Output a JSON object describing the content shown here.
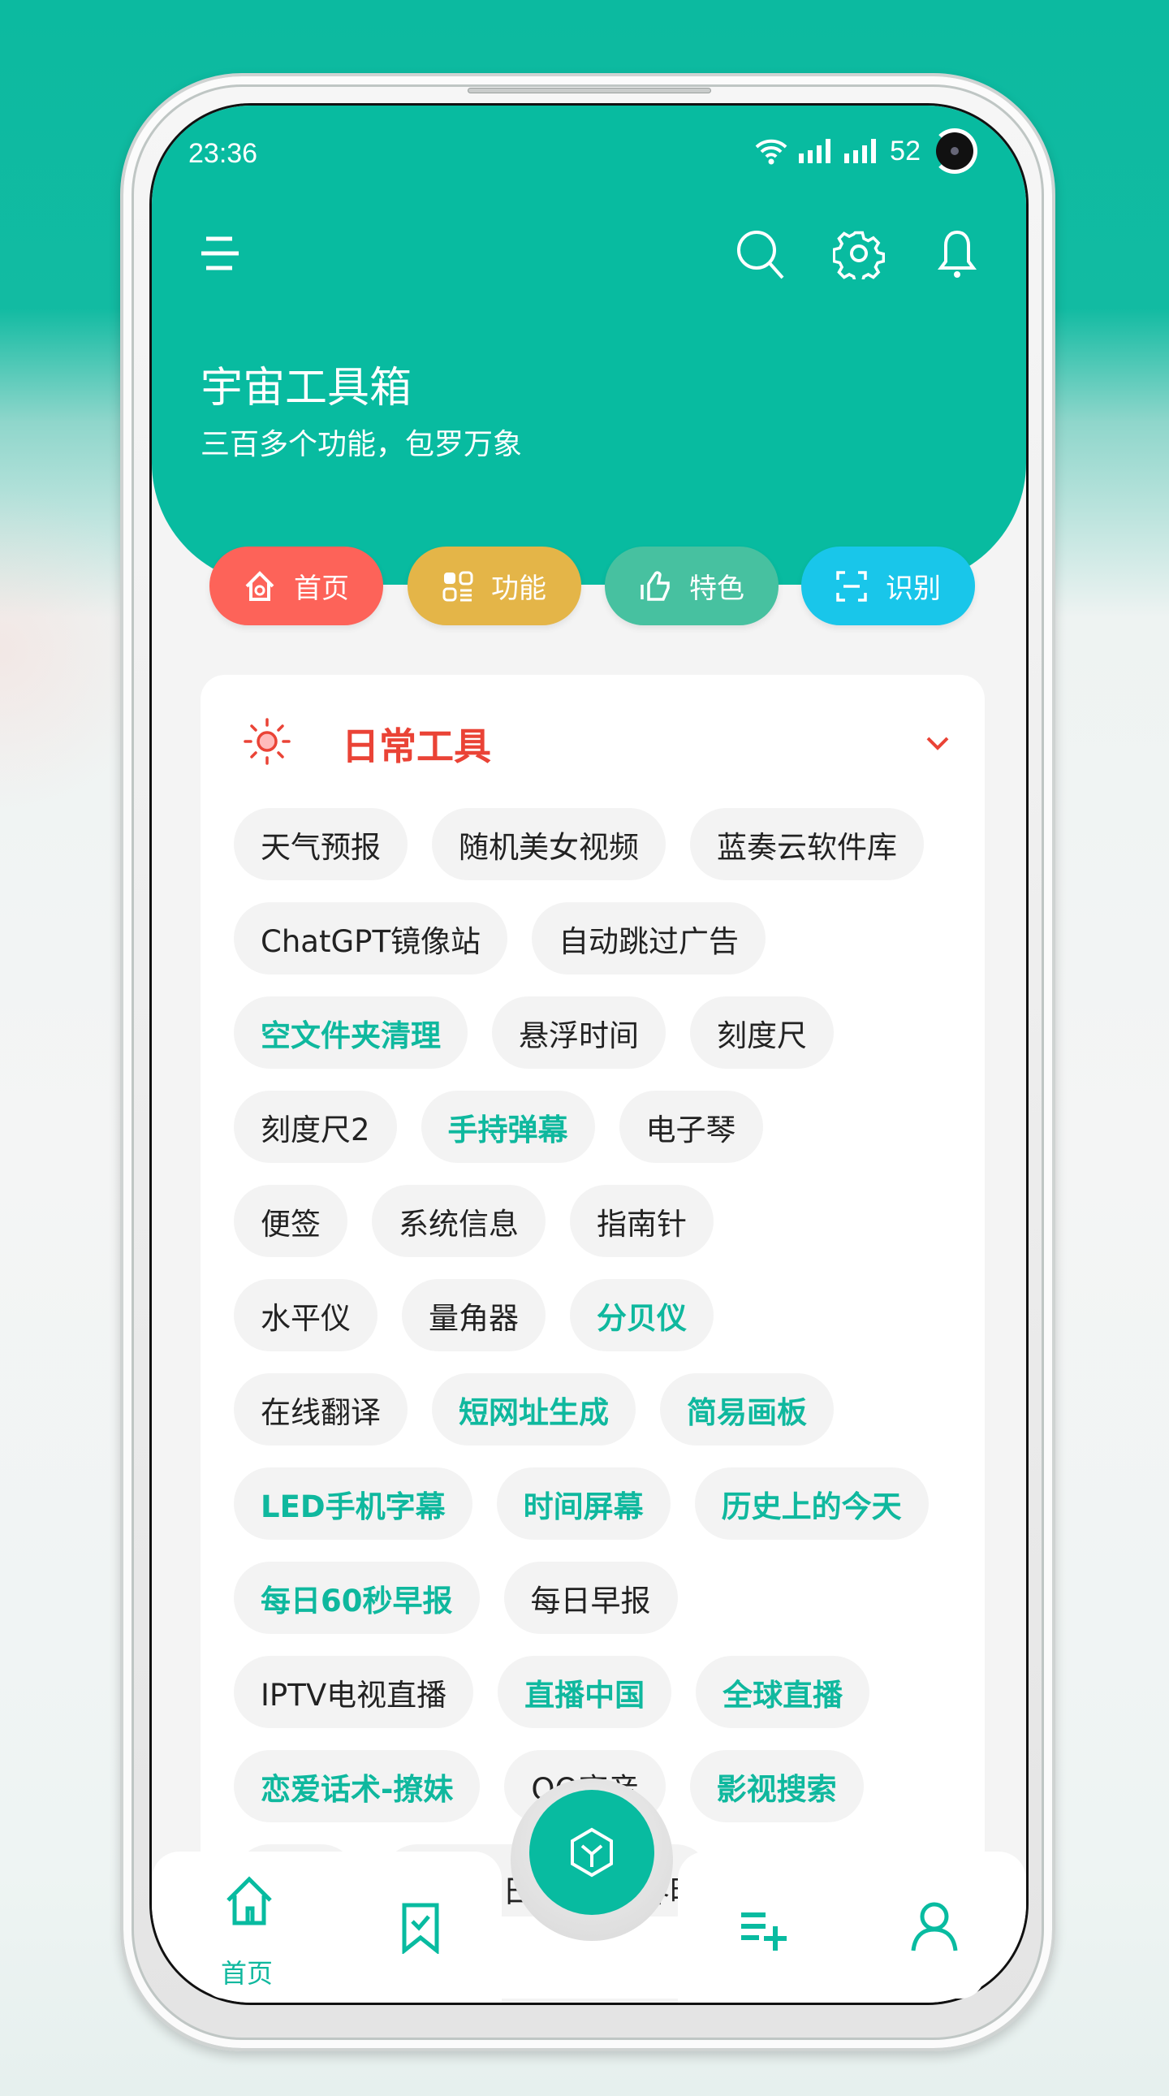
{
  "status_bar": {
    "time": "23:36",
    "battery": "52"
  },
  "header": {
    "title": "宇宙工具箱",
    "subtitle": "三百多个功能，包罗万象"
  },
  "toolbar": {
    "icons": [
      "menu-icon",
      "search-icon",
      "gear-icon",
      "bell-icon"
    ]
  },
  "quick_nav": [
    {
      "label": "首页",
      "icon": "home-icon",
      "color": "#fd6359"
    },
    {
      "label": "功能",
      "icon": "grid-icon",
      "color": "#e4b548"
    },
    {
      "label": "特色",
      "icon": "thumbs-up-icon",
      "color": "#47c1a0"
    },
    {
      "label": "识别",
      "icon": "scan-icon",
      "color": "#19c6ea"
    }
  ],
  "section": {
    "title": "日常工具",
    "icon": "sun-icon",
    "color": "#ea4336",
    "rows": [
      [
        {
          "label": "天气预报",
          "hl": false
        },
        {
          "label": "随机美女视频",
          "hl": false
        },
        {
          "label": "蓝奏云软件库",
          "hl": false
        }
      ],
      [
        {
          "label": "ChatGPT镜像站",
          "hl": false
        },
        {
          "label": "自动跳过广告",
          "hl": false
        }
      ],
      [
        {
          "label": "空文件夹清理",
          "hl": true
        },
        {
          "label": "悬浮时间",
          "hl": false
        },
        {
          "label": "刻度尺",
          "hl": false
        }
      ],
      [
        {
          "label": "刻度尺2",
          "hl": false
        },
        {
          "label": "手持弹幕",
          "hl": true
        },
        {
          "label": "电子琴",
          "hl": false
        }
      ],
      [
        {
          "label": "便签",
          "hl": false
        },
        {
          "label": "系统信息",
          "hl": false
        },
        {
          "label": "指南针",
          "hl": false
        }
      ],
      [
        {
          "label": "水平仪",
          "hl": false
        },
        {
          "label": "量角器",
          "hl": false
        },
        {
          "label": "分贝仪",
          "hl": true
        }
      ],
      [
        {
          "label": "在线翻译",
          "hl": false
        },
        {
          "label": "短网址生成",
          "hl": true
        },
        {
          "label": "简易画板",
          "hl": true
        }
      ],
      [
        {
          "label": "LED手机字幕",
          "hl": true
        },
        {
          "label": "时间屏幕",
          "hl": true
        },
        {
          "label": "历史上的今天",
          "hl": true
        }
      ],
      [
        {
          "label": "每日60秒早报",
          "hl": true
        },
        {
          "label": "每日早报",
          "hl": false
        }
      ],
      [
        {
          "label": "IPTV电视直播",
          "hl": false
        },
        {
          "label": "直播中国",
          "hl": true
        },
        {
          "label": "全球直播",
          "hl": true
        }
      ],
      [
        {
          "label": "恋爱话术-撩妹",
          "hl": true
        },
        {
          "label": "QQ变音",
          "hl": false
        },
        {
          "label": "影视搜索",
          "hl": true
        }
      ]
    ],
    "partial_fragments": [
      "日",
      "界时"
    ]
  },
  "bottom_nav": {
    "items": [
      {
        "label": "首页",
        "icon": "home-icon"
      },
      {
        "icon": "bookmark-check-icon"
      },
      {
        "icon": "cube-icon"
      },
      {
        "icon": "playlist-add-icon"
      },
      {
        "icon": "user-icon"
      }
    ],
    "accent": "#08bba0"
  }
}
